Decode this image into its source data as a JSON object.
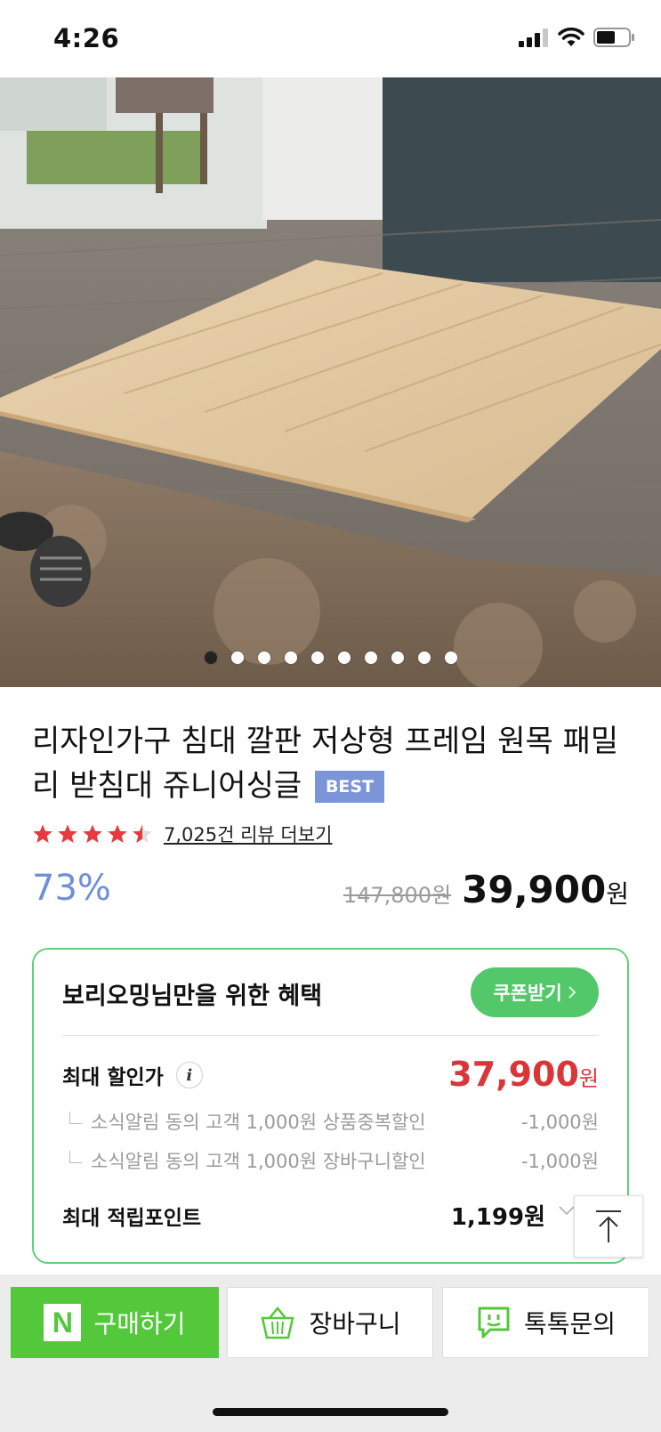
{
  "status_bar": {
    "time": "4:26"
  },
  "hero": {
    "slide_count": 10,
    "active_slide": 0
  },
  "product": {
    "title": "리자인가구 침대 깔판 저상형 프레임 원목 패밀리 받침대 쥬니어싱글",
    "badge": "BEST",
    "rating_stars": 4.5,
    "review_link": "7,025건 리뷰 더보기",
    "discount_rate": "73%",
    "original_price": "147,800원",
    "price": "39,900",
    "price_unit": "원"
  },
  "benefit": {
    "title": "보리오밍님만을 위한 혜택",
    "coupon_button": "쿠폰받기",
    "max_discount_label": "최대 할인가",
    "max_discount_price": "37,900",
    "max_discount_unit": "원",
    "items": [
      {
        "label": "소식알림 동의 고객 1,000원 상품중복할인",
        "value": "-1,000원"
      },
      {
        "label": "소식알림 동의 고객 1,000원 장바구니할인",
        "value": "-1,000원"
      }
    ],
    "point_label": "최대 적립포인트",
    "point_value": "1,199원"
  },
  "actions": {
    "buy": "구매하기",
    "cart": "장바구니",
    "talk": "톡톡문의"
  },
  "colors": {
    "naver_green": "#52c83a",
    "badge_blue": "#7b95d8",
    "discount_blue": "#6f8fd6",
    "sale_red": "#d9363a",
    "star_red": "#e8393f"
  },
  "icons": [
    "signal-icon",
    "wifi-icon",
    "battery-icon",
    "star-icon",
    "info-icon",
    "chevron-right-icon",
    "chevron-down-icon",
    "scroll-top-icon",
    "naver-n-icon",
    "cart-icon",
    "talktalk-icon"
  ]
}
